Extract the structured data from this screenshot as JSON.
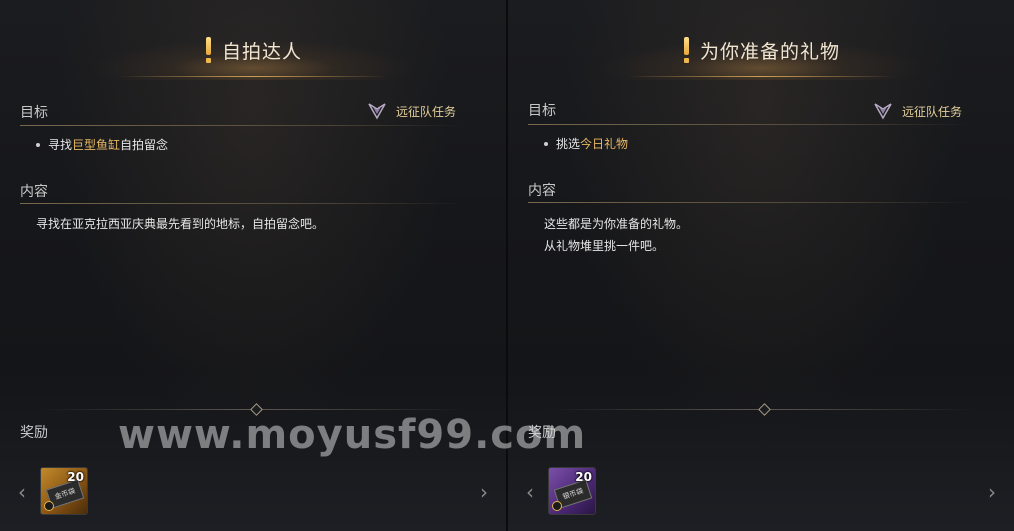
{
  "panels": [
    {
      "title": "自拍达人",
      "objective_label": "目标",
      "task_type": "远征队任务",
      "objective": {
        "prefix": "寻找",
        "highlight": "巨型鱼缸",
        "suffix": "自拍留念"
      },
      "content_label": "内容",
      "content": "寻找在亚克拉西亚庆典最先看到的地标，自拍留念吧。",
      "reward_label": "奖励",
      "reward_item": {
        "name": "金币袋",
        "count": "20",
        "color": "#c28a2c"
      }
    },
    {
      "title": "为你准备的礼物",
      "objective_label": "目标",
      "task_type": "远征队任务",
      "objective": {
        "prefix": "挑选",
        "highlight": "今日礼物",
        "suffix": ""
      },
      "content_label": "内容",
      "content": "这些都是为你准备的礼物。\n从礼物堆里挑一件吧。",
      "reward_label": "奖励",
      "reward_item": {
        "name": "银币袋",
        "count": "20",
        "color": "#7a4fa8"
      }
    }
  ],
  "watermark": "www.moyusf99.com",
  "icons": {
    "exclaim": "exclamation-icon",
    "task_type": "expedition-crest-icon",
    "prev": "chevron-left-icon",
    "next": "chevron-right-icon",
    "clock": "clock-icon"
  }
}
